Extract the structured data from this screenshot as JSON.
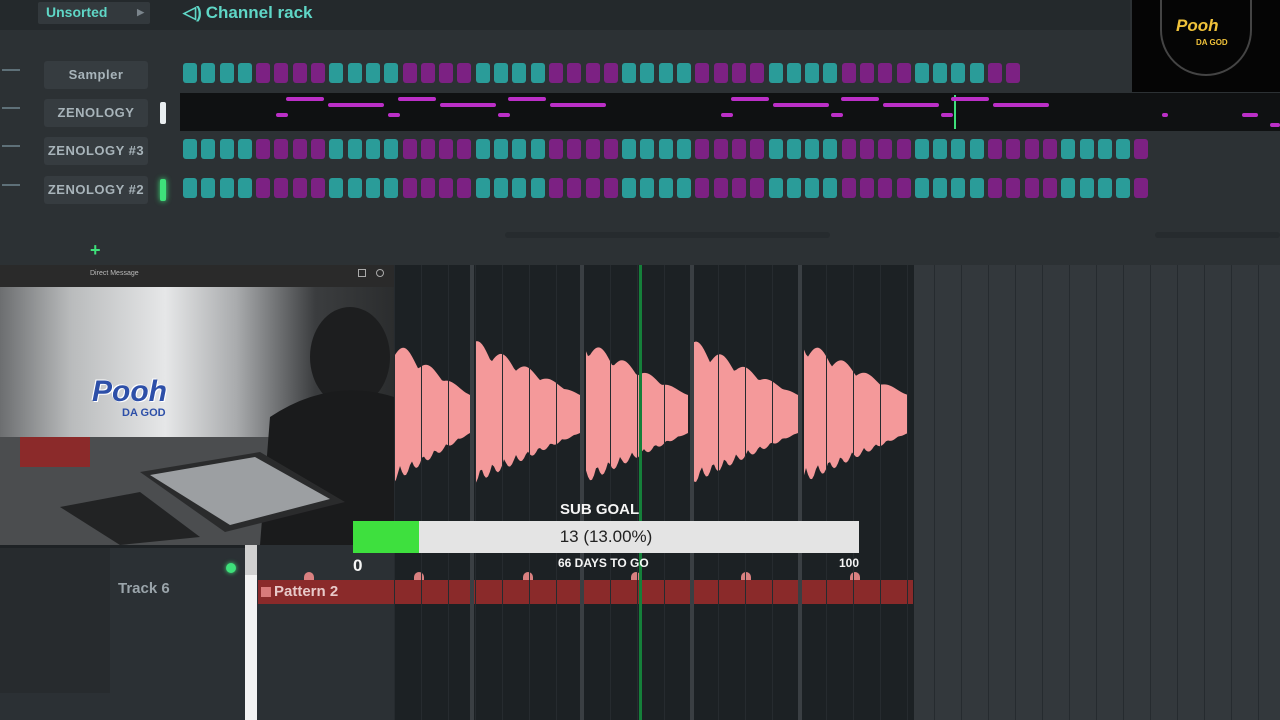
{
  "channel_rack": {
    "filter": "Unsorted",
    "title": "Channel rack",
    "channels": [
      {
        "name": "Sampler"
      },
      {
        "name": "ZENOLOGY"
      },
      {
        "name": "ZENOLOGY #3"
      },
      {
        "name": "ZENOLOGY #2"
      }
    ]
  },
  "logo": {
    "text": "Pooh",
    "sub": "DA GOD"
  },
  "webcam": {
    "title": "Direct Message",
    "logo_text": "Pooh",
    "logo_sub": "DA GOD"
  },
  "playlist": {
    "track_label": "Track 6",
    "pattern_label": "Pattern 2"
  },
  "sub_goal": {
    "label": "SUB GOAL",
    "progress_text": "13 (13.00%)",
    "progress_fraction": 0.13,
    "min": "0",
    "max": "100",
    "days_text": "66 DAYS TO GO"
  },
  "colors": {
    "accent": "#5fd6c6",
    "step_teal": "#2a9c99",
    "step_purple": "#7c2183",
    "roll_note": "#bb2fc7",
    "waveform": "#f4999a",
    "pattern": "#8a2a2a",
    "goal_fill": "#3ee03e"
  }
}
